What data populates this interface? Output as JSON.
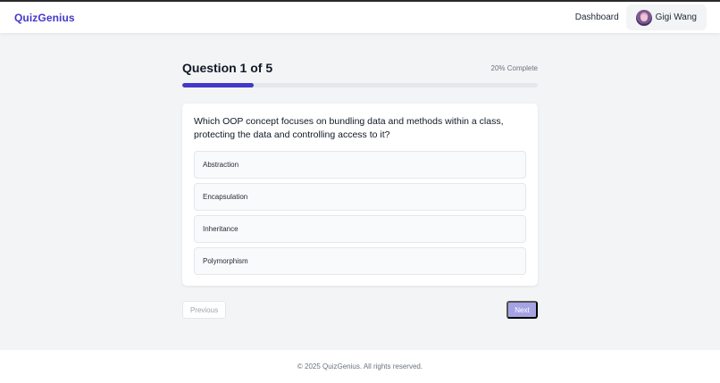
{
  "header": {
    "logo": "QuizGenius",
    "nav": {
      "dashboard_label": "Dashboard"
    },
    "user": {
      "name": "Gigi Wang"
    }
  },
  "quiz": {
    "title": "Question 1 of 5",
    "progress_text": "20% Complete",
    "progress_percent": 20,
    "question": "Which OOP concept focuses on bundling data and methods within a class, protecting the data and controlling access to it?",
    "options": [
      {
        "label": "Abstraction"
      },
      {
        "label": "Encapsulation"
      },
      {
        "label": "Inheritance"
      },
      {
        "label": "Polymorphism"
      }
    ],
    "previous_label": "Previous",
    "next_label": "Next"
  },
  "footer": {
    "text": "© 2025 QuizGenius. All rights reserved."
  },
  "colors": {
    "brand": "#4338ca",
    "next_button_disabled": "#a5a3e3"
  }
}
